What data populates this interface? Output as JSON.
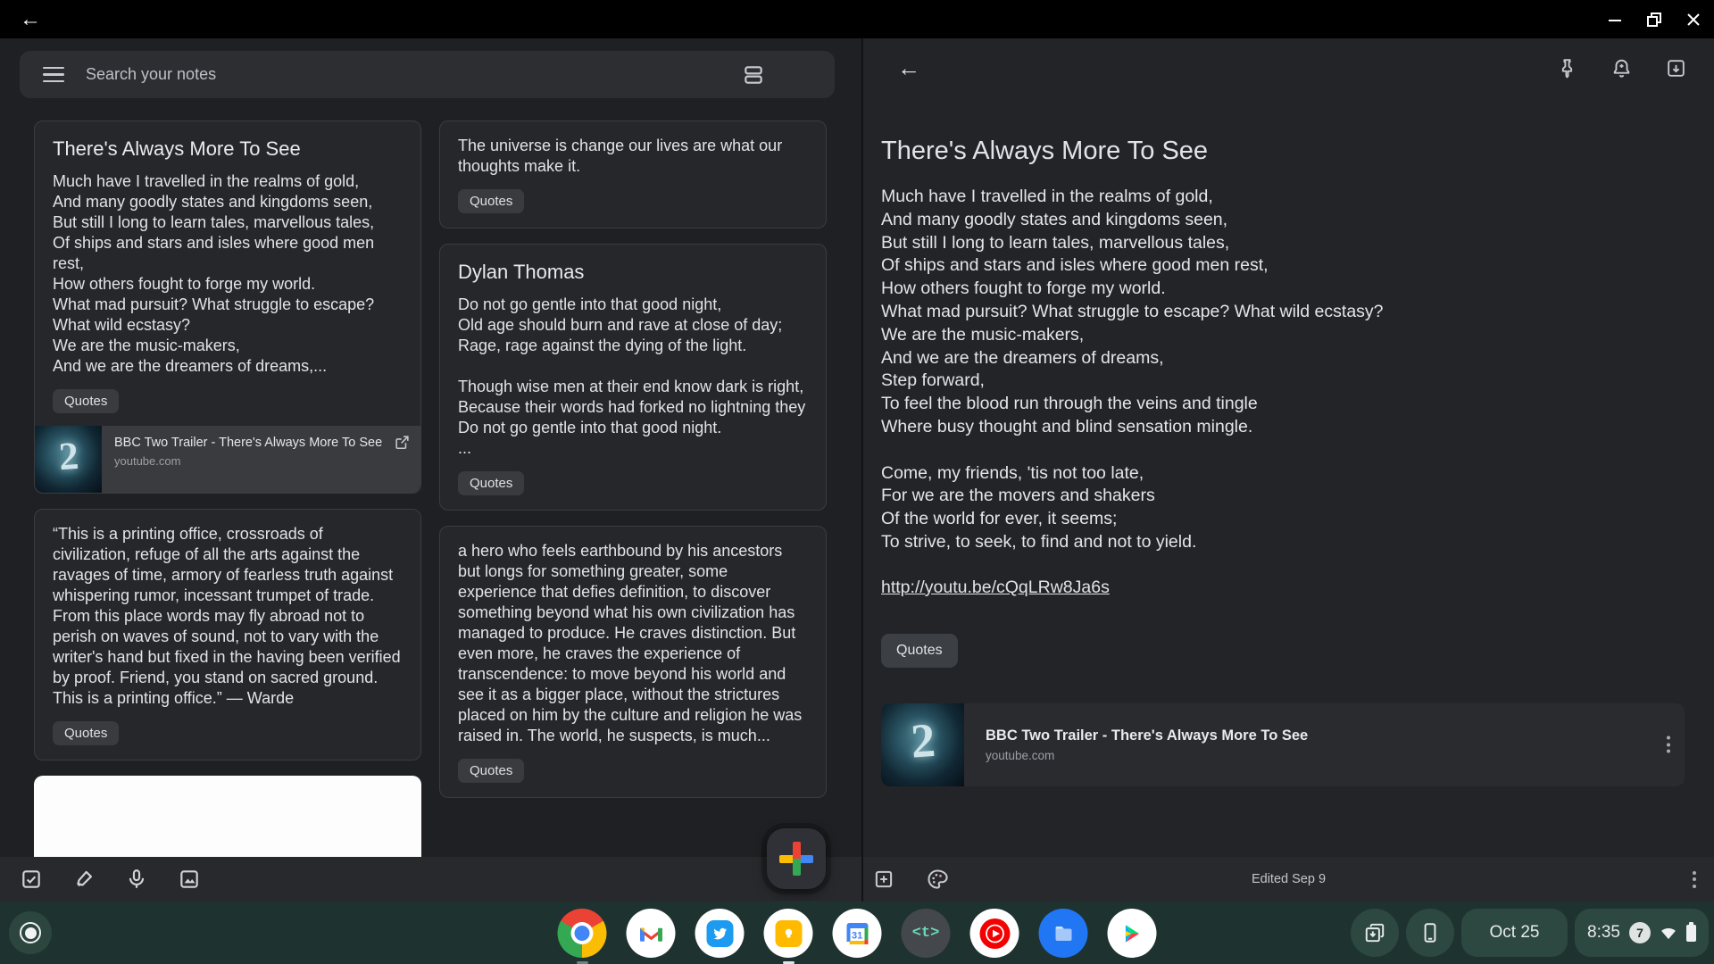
{
  "keep": {
    "search": {
      "placeholder": "Search your notes"
    },
    "notes": [
      {
        "title": "There's Always More To See",
        "body": "Much have I travelled in the realms of gold,\nAnd many goodly states and kingdoms seen,\nBut still I long to learn tales, marvellous tales,\nOf ships and stars and isles where good men rest,\nHow others fought to forge my world.\nWhat mad pursuit? What struggle to escape?\nWhat wild ecstasy?\nWe are the music-makers,\nAnd we are the dreamers of dreams,...",
        "label": "Quotes",
        "attachment": {
          "title": "BBC Two Trailer - There's Always More To See",
          "domain": "youtube.com"
        }
      },
      {
        "title": "",
        "body": "The universe is change our lives are what our thoughts make it.",
        "label": "Quotes"
      },
      {
        "title": "Dylan Thomas",
        "body": "Do not go gentle into that good night,\nOld age should burn and rave at close of day;\nRage, rage against the dying of the light.\n\nThough wise men at their end know dark is right,\nBecause their words had forked no lightning they\nDo not go gentle into that good night.\n...",
        "label": "Quotes"
      },
      {
        "title": "",
        "body": "“This is a printing office, crossroads of civilization, refuge of all the arts against the ravages of time, armory of fearless truth against whispering rumor, incessant trumpet of trade. From this place words may fly abroad not to perish on waves of sound, not to vary with the writer's hand but fixed in the having been verified by proof. Friend, you stand on sacred ground. This is a printing office.” — Warde",
        "label": "Quotes"
      },
      {
        "title": "",
        "body": "a hero who feels earthbound by his ancestors but longs for something greater, some experience that defies definition, to discover something beyond what his own civilization has managed to produce. He craves distinction. But even more, he craves the experience of transcendence: to move beyond his world and see it as a bigger place, without the strictures placed on him by the culture and religion he was raised in. The world, he suspects, is much...",
        "label": "Quotes"
      }
    ],
    "white_note_color": "#fdfdfd",
    "attachment_thumb_text": "2",
    "detail": {
      "title": "There's Always More To See",
      "body": "Much have I travelled in the realms of gold,\nAnd many goodly states and kingdoms seen,\nBut still I long to learn tales, marvellous tales,\nOf ships and stars and isles where good men rest,\nHow others fought to forge my world.\nWhat mad pursuit? What struggle to escape? What wild ecstasy?\nWe are the music-makers,\nAnd we are the dreamers of dreams,\nStep forward,\nTo feel the blood run through the veins and tingle\nWhere busy thought and blind sensation mingle.\n\nCome, my friends, 'tis not too late,\nFor we are the movers and shakers\nOf the world for ever, it seems;\nTo strive, to seek, to find and not to yield.",
      "link": "http://youtu.be/cQqLRw8Ja6s",
      "label": "Quotes",
      "attachment": {
        "title": "BBC Two Trailer - There's Always More To See",
        "domain": "youtube.com"
      },
      "edited": "Edited Sep 9"
    }
  },
  "shelf": {
    "date": "Oct 25",
    "time": "8:35",
    "notification_count": "7",
    "text_app_glyph": "<t>",
    "calendar_day": "31",
    "apps": [
      "chrome",
      "gmail",
      "twitter",
      "keep",
      "calendar",
      "text",
      "youtube-music",
      "files",
      "play-store"
    ]
  },
  "colors": {
    "shelf_bg": "#1e332f",
    "pane_bg": "#1f2023",
    "card_bg": "#26272b",
    "accent_red": "#ea4335",
    "accent_yellow": "#fbbc04",
    "accent_blue": "#4285f4",
    "accent_green": "#34a853"
  }
}
